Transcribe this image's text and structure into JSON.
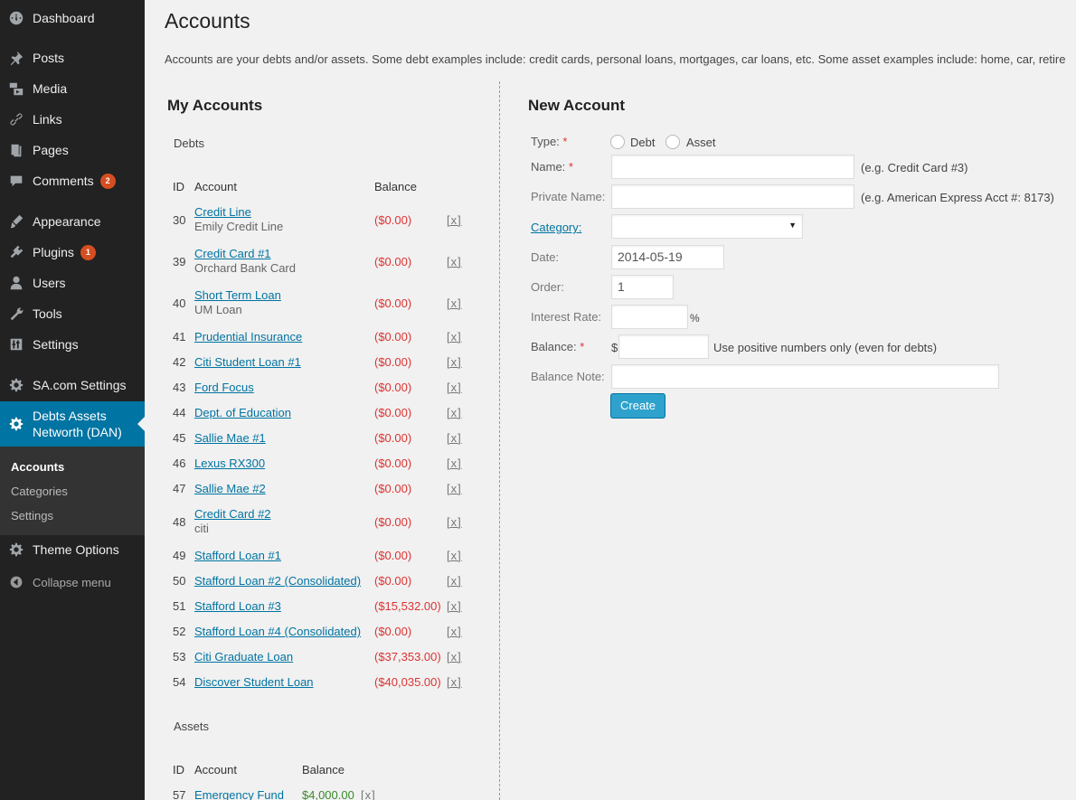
{
  "sidebar": {
    "items": [
      {
        "label": "Dashboard",
        "icon": "dashboard-icon"
      },
      {
        "label": "Posts",
        "icon": "pin-icon"
      },
      {
        "label": "Media",
        "icon": "media-icon"
      },
      {
        "label": "Links",
        "icon": "link-icon"
      },
      {
        "label": "Pages",
        "icon": "pages-icon"
      },
      {
        "label": "Comments",
        "icon": "comments-icon",
        "badge": "2"
      },
      {
        "label": "Appearance",
        "icon": "brush-icon"
      },
      {
        "label": "Plugins",
        "icon": "plugin-icon",
        "badge": "1"
      },
      {
        "label": "Users",
        "icon": "user-icon"
      },
      {
        "label": "Tools",
        "icon": "wrench-icon"
      },
      {
        "label": "Settings",
        "icon": "sliders-icon"
      },
      {
        "label": "SA.com Settings",
        "icon": "gear-icon"
      },
      {
        "label": "Debts Assets Networth (DAN)",
        "label_line1": "Debts Assets",
        "label_line2": "Networth (DAN)",
        "icon": "gear-icon"
      }
    ],
    "submenu": [
      "Accounts",
      "Categories",
      "Settings"
    ],
    "theme_options": "Theme Options",
    "collapse": "Collapse menu"
  },
  "page": {
    "title": "Accounts",
    "description": "Accounts are your debts and/or assets. Some debt examples include: credit cards, personal loans, mortgages, car loans, etc. Some asset examples include: home, car, retire"
  },
  "my_accounts": {
    "heading": "My Accounts",
    "debts_label": "Debts",
    "columns": {
      "id": "ID",
      "account": "Account",
      "balance": "Balance"
    },
    "delete_label": "[x]",
    "debts": [
      {
        "id": "30",
        "name": "Credit Line",
        "note": "Emily Credit Line",
        "balance": "($0.00)"
      },
      {
        "id": "39",
        "name": "Credit Card #1",
        "note": "Orchard Bank Card",
        "balance": "($0.00)"
      },
      {
        "id": "40",
        "name": "Short Term Loan",
        "note": "UM Loan",
        "balance": "($0.00)"
      },
      {
        "id": "41",
        "name": "Prudential Insurance",
        "note": "",
        "balance": "($0.00)"
      },
      {
        "id": "42",
        "name": "Citi Student Loan #1",
        "note": "",
        "balance": "($0.00)"
      },
      {
        "id": "43",
        "name": "Ford Focus",
        "note": "",
        "balance": "($0.00)"
      },
      {
        "id": "44",
        "name": "Dept. of Education",
        "note": "",
        "balance": "($0.00)"
      },
      {
        "id": "45",
        "name": "Sallie Mae #1",
        "note": "",
        "balance": "($0.00)"
      },
      {
        "id": "46",
        "name": "Lexus RX300",
        "note": "",
        "balance": "($0.00)"
      },
      {
        "id": "47",
        "name": "Sallie Mae #2",
        "note": "",
        "balance": "($0.00)"
      },
      {
        "id": "48",
        "name": "Credit Card #2",
        "note": "citi",
        "balance": "($0.00)"
      },
      {
        "id": "49",
        "name": "Stafford Loan #1",
        "note": "",
        "balance": "($0.00)"
      },
      {
        "id": "50",
        "name": "Stafford Loan #2 (Consolidated)",
        "note": "",
        "balance": "($0.00)"
      },
      {
        "id": "51",
        "name": "Stafford Loan #3",
        "note": "",
        "balance": "($15,532.00)"
      },
      {
        "id": "52",
        "name": "Stafford Loan #4 (Consolidated)",
        "note": "",
        "balance": "($0.00)"
      },
      {
        "id": "53",
        "name": "Citi Graduate Loan",
        "note": "",
        "balance": "($37,353.00)"
      },
      {
        "id": "54",
        "name": "Discover Student Loan",
        "note": "",
        "balance": "($40,035.00)"
      }
    ],
    "assets_label": "Assets",
    "assets": [
      {
        "id": "57",
        "name": "Emergency Fund",
        "note": "",
        "balance": "$4,000.00"
      }
    ]
  },
  "new_account": {
    "heading": "New Account",
    "type_label": "Type:",
    "type_options": [
      "Debt",
      "Asset"
    ],
    "name_label": "Name:",
    "name_hint": "(e.g. Credit Card #3)",
    "private_name_label": "Private Name:",
    "private_name_hint": "(e.g. American Express Acct #: 8173)",
    "category_label": "Category:",
    "date_label": "Date:",
    "date_value": "2014-05-19",
    "order_label": "Order:",
    "order_value": "1",
    "interest_label": "Interest Rate:",
    "interest_suffix": "%",
    "balance_label": "Balance:",
    "balance_prefix": "$",
    "balance_hint": "Use positive numbers only (even for debts)",
    "balance_note_label": "Balance Note:",
    "required_mark": "*",
    "create_button": "Create"
  },
  "colors": {
    "sidebar_bg": "#222222",
    "active_menu": "#0074a2",
    "link": "#0074a2",
    "debt_balance": "#dd3333",
    "asset_balance": "#3a8a2a",
    "button": "#2ea2cc",
    "badge": "#d54e21"
  }
}
